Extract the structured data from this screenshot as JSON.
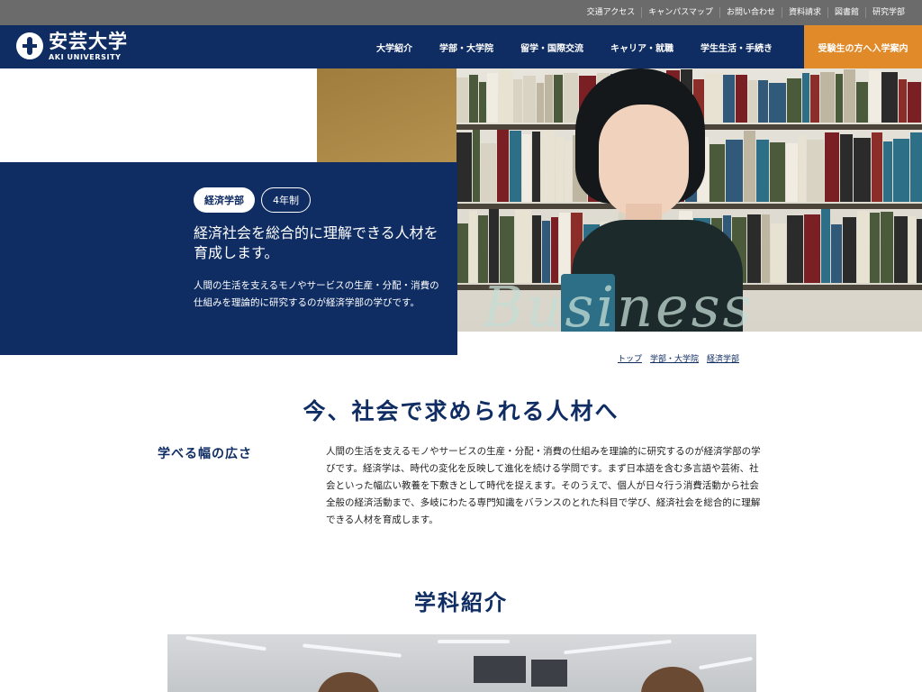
{
  "utility_nav": [
    "交通アクセス",
    "キャンパスマップ",
    "お問い合わせ",
    "資料請求",
    "図書館",
    "研究学部"
  ],
  "logo": {
    "name": "安芸大学",
    "sub": "AKI UNIVERSITY"
  },
  "global_nav": [
    "大学紹介",
    "学部・大学院",
    "留学・国際交流",
    "キャリア・就職",
    "学生生活・手続き"
  ],
  "cta": "受験生の方へ入学案内",
  "hero": {
    "badge_faculty": "経済学部",
    "badge_years": "4年制",
    "headline": "経済社会を総合的に理解できる人材を育成します。",
    "description": "人間の生活を支えるモノやサービスの生産・分配・消費の仕組みを理論的に研究するのが経済学部の学びです。",
    "script_text": "Business"
  },
  "breadcrumb": [
    "トップ",
    "学部・大学院",
    "経済学部"
  ],
  "section1": {
    "title": "今、社会で求められる人材へ",
    "feature_heading": "学べる幅の広さ",
    "feature_text": "人間の生活を支えるモノやサービスの生産・分配・消費の仕組みを理論的に研究するのが経済学部の学びです。経済学は、時代の変化を反映して進化を続ける学問です。まず日本語を含む多言語や芸術、社会といった幅広い教養を下敷きとして時代を捉えます。そのうえで、個人が日々行う消費活動から社会全般の経済活動まで、多岐にわたる専門知識をバランスのとれた科目で学び、経済社会を総合的に理解できる人材を育成します。"
  },
  "section2": {
    "title": "学科紹介"
  },
  "colors": {
    "navy": "#0f2d63",
    "orange": "#e08a2a",
    "utility_gray": "#6b6b6b",
    "tan": "#a07c3d"
  }
}
